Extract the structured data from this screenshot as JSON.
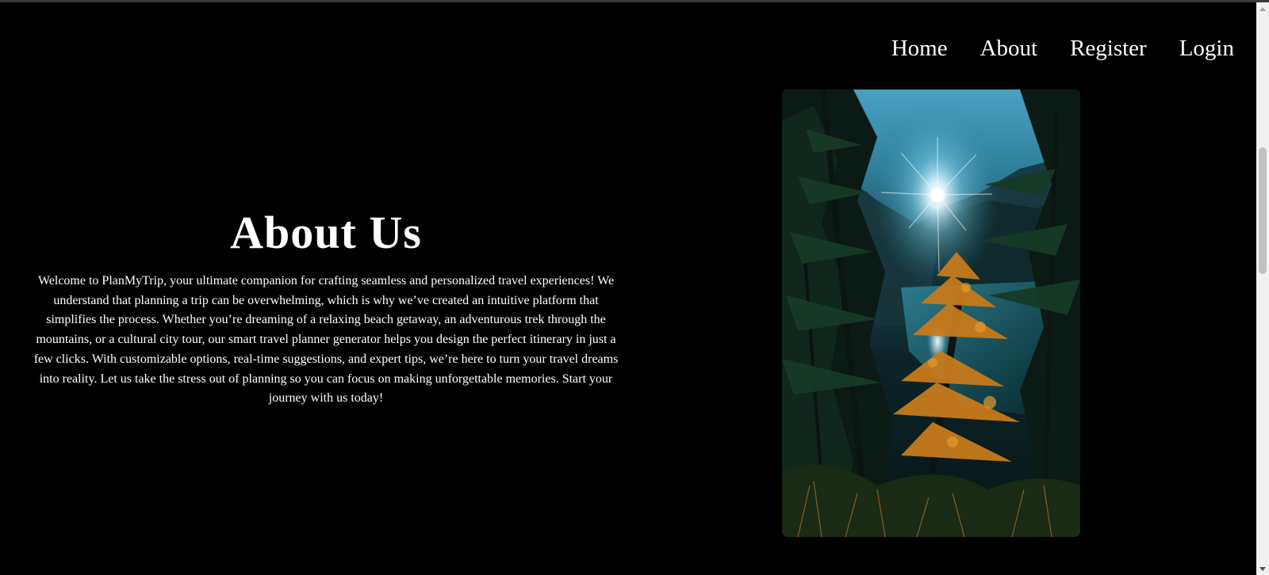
{
  "nav": {
    "items": [
      {
        "label": "Home"
      },
      {
        "label": "About"
      },
      {
        "label": "Register"
      },
      {
        "label": "Login"
      }
    ]
  },
  "about": {
    "title": "About Us",
    "paragraph": "Welcome to PlanMyTrip, your ultimate companion for crafting seamless and personalized travel experiences! We understand that planning a trip can be overwhelming, which is why we’ve created an intuitive platform that simplifies the process. Whether you’re dreaming of a relaxing beach getaway, an adventurous trek through the mountains, or a cultural city tour, our smart travel planner generator helps you design the perfect itinerary in just a few clicks. With customizable options, real-time suggestions, and expert tips, we’re here to turn your travel dreams into reality. Let us take the stress out of planning so you can focus on making unforgettable memories. Start your journey with us today!"
  },
  "colors": {
    "background": "#000000",
    "text": "#ffffff",
    "scrollbar_track": "#f1f1f1",
    "scrollbar_thumb": "#c1c1c1"
  },
  "icons": {
    "scroll_up": "triangle-up",
    "scroll_down": "triangle-down"
  }
}
